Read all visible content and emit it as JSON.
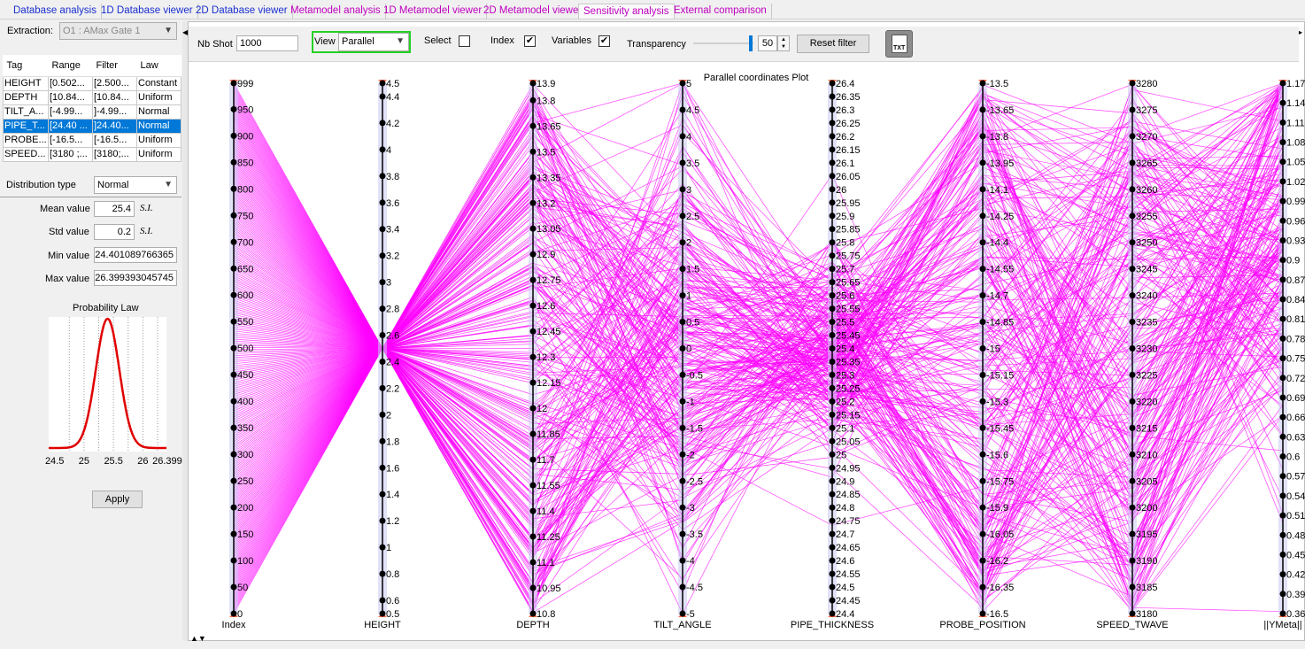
{
  "tabs": [
    {
      "label": "Database analysis",
      "color": "#1a2fd0",
      "active": false
    },
    {
      "label": "1D Database viewer",
      "color": "#1a2fd0",
      "active": false
    },
    {
      "label": "2D Database viewer",
      "color": "#1a2fd0",
      "active": false
    },
    {
      "label": "Metamodel analysis",
      "color": "#c000c0",
      "active": false
    },
    {
      "label": "1D Metamodel viewer",
      "color": "#c000c0",
      "active": false
    },
    {
      "label": "2D Metamodel viewer",
      "color": "#c000c0",
      "active": false
    },
    {
      "label": "Sensitivity analysis",
      "color": "#c000c0",
      "active": true
    },
    {
      "label": "External comparison",
      "color": "#c000c0",
      "active": false
    }
  ],
  "left": {
    "extraction_label": "Extraction:",
    "extraction_value": "O1 : AMax Gate 1",
    "table_headers": [
      "Tag",
      "Range",
      "Filter",
      "Law"
    ],
    "table_rows": [
      {
        "tag": "HEIGHT",
        "range": "[0.502...",
        "filter": "[2.500...",
        "law": "Constant",
        "selected": false
      },
      {
        "tag": "DEPTH",
        "range": "[10.84...",
        "filter": "[10.84...",
        "law": "Uniform",
        "selected": false
      },
      {
        "tag": "TILT_A...",
        "range": "[-4.99...",
        "filter": "]-4.99...",
        "law": "Normal",
        "selected": false
      },
      {
        "tag": "PIPE_T...",
        "range": "[24.40 ...",
        "filter": "]24.40...",
        "law": "Normal",
        "selected": true
      },
      {
        "tag": "PROBE...",
        "range": "[-16.5...",
        "filter": "[-16.5...",
        "law": "Uniform",
        "selected": false
      },
      {
        "tag": "SPEED...",
        "range": "[3180 ;...",
        "filter": "[3180;...",
        "law": "Uniform",
        "selected": false
      }
    ],
    "dist_type_label": "Distribution type",
    "dist_type_value": "Normal",
    "mean_label": "Mean value",
    "mean_value": "25.4",
    "std_label": "Std value",
    "std_value": "0.2",
    "min_label": "Min value",
    "min_value": "24.401089766365",
    "max_label": "Max value",
    "max_value": "26.399393045745",
    "unit": "S.I.",
    "prob_title": "Probability Law",
    "prob_ticks": [
      "24.5",
      "25",
      "25.5",
      "26",
      "26.399"
    ],
    "apply_label": "Apply",
    "curve_color": "#e00000"
  },
  "toolbar": {
    "nbshot_label": "Nb Shot",
    "nbshot_value": "1000",
    "view_label": "View",
    "view_value": "Parallel",
    "select_label": "Select",
    "select_checked": false,
    "index_label": "Index",
    "index_checked": true,
    "variables_label": "Variables",
    "variables_checked": true,
    "transparency_label": "Transparency",
    "transparency_value": "50",
    "transparency_fraction": 0.95,
    "reset_label": "Reset filter",
    "export_icon_text": "TXT"
  },
  "chart_data": {
    "type": "parallel",
    "title": "Parallel coordinates Plot",
    "line_color": "#ff00ff",
    "n_lines": 1000,
    "axes": [
      {
        "name": "Index",
        "min": 0,
        "max": 999,
        "ticks": [
          "0",
          "50",
          "100",
          "150",
          "200",
          "250",
          "300",
          "350",
          "400",
          "450",
          "500",
          "550",
          "600",
          "650",
          "700",
          "750",
          "800",
          "850",
          "900",
          "950",
          "999"
        ]
      },
      {
        "name": "HEIGHT",
        "min": 0.5,
        "max": 4.5,
        "ticks": [
          "0.5",
          "0.6",
          "0.8",
          "1",
          "1.2",
          "1.4",
          "1.6",
          "1.8",
          "2",
          "2.2",
          "2.4",
          "2.6",
          "2.8",
          "3",
          "3.2",
          "3.4",
          "3.6",
          "3.8",
          "4",
          "4.2",
          "4.4",
          "4.5"
        ]
      },
      {
        "name": "DEPTH",
        "min": 10.8,
        "max": 13.9,
        "ticks": [
          "10.8",
          "10.95",
          "11.1",
          "11.25",
          "11.4",
          "11.55",
          "11.7",
          "11.85",
          "12",
          "12.15",
          "12.3",
          "12.45",
          "12.6",
          "12.75",
          "12.9",
          "13.05",
          "13.2",
          "13.35",
          "13.5",
          "13.65",
          "13.8",
          "13.9"
        ]
      },
      {
        "name": "TILT_ANGLE",
        "min": -5,
        "max": 5,
        "ticks": [
          "-5",
          "-4.5",
          "-4",
          "-3.5",
          "-3",
          "-2.5",
          "-2",
          "-1.5",
          "-1",
          "-0.5",
          "0",
          "0.5",
          "1",
          "1.5",
          "2",
          "2.5",
          "3",
          "3.5",
          "4",
          "4.5",
          "5"
        ]
      },
      {
        "name": "PIPE_THICKNESS",
        "min": 24.4,
        "max": 26.4,
        "ticks": [
          "24.4",
          "24.45",
          "24.5",
          "24.55",
          "24.6",
          "24.65",
          "24.7",
          "24.75",
          "24.8",
          "24.85",
          "24.9",
          "24.95",
          "25",
          "25.05",
          "25.1",
          "25.15",
          "25.2",
          "25.25",
          "25.3",
          "25.35",
          "25.4",
          "25.45",
          "25.5",
          "25.55",
          "25.6",
          "25.65",
          "25.7",
          "25.75",
          "25.8",
          "25.85",
          "25.9",
          "25.95",
          "26",
          "26.05",
          "26.1",
          "26.15",
          "26.2",
          "26.25",
          "26.3",
          "26.35",
          "26.4"
        ]
      },
      {
        "name": "PROBE_POSITION",
        "min": -16.5,
        "max": -13.5,
        "ticks": [
          "-16.5",
          "-16.35",
          "-16.2",
          "-16.05",
          "-15.9",
          "-15.75",
          "-15.6",
          "-15.45",
          "-15.3",
          "-15.15",
          "-15",
          "-14.85",
          "-14.7",
          "-14.55",
          "-14.4",
          "-14.25",
          "-14.1",
          "-13.95",
          "-13.8",
          "-13.65",
          "-13.5"
        ]
      },
      {
        "name": "SPEED_TWAVE",
        "min": 3180,
        "max": 3280,
        "ticks": [
          "3180",
          "3185",
          "3190",
          "3195",
          "3200",
          "3205",
          "3210",
          "3215",
          "3220",
          "3225",
          "3230",
          "3235",
          "3240",
          "3245",
          "3250",
          "3255",
          "3260",
          "3265",
          "3270",
          "3275",
          "3280"
        ]
      },
      {
        "name": "||YMeta||",
        "min": 0.36,
        "max": 1.17,
        "ticks": [
          "0.36",
          "0.39",
          "0.42",
          "0.45",
          "0.48",
          "0.51",
          "0.54",
          "0.57",
          "0.6",
          "0.63",
          "0.66",
          "0.69",
          "0.72",
          "0.75",
          "0.78",
          "0.81",
          "0.84",
          "0.87",
          "0.9",
          "0.93",
          "0.96",
          "0.99",
          "1.02",
          "1.05",
          "1.08",
          "1.11",
          "1.14",
          "1.17"
        ]
      }
    ]
  }
}
